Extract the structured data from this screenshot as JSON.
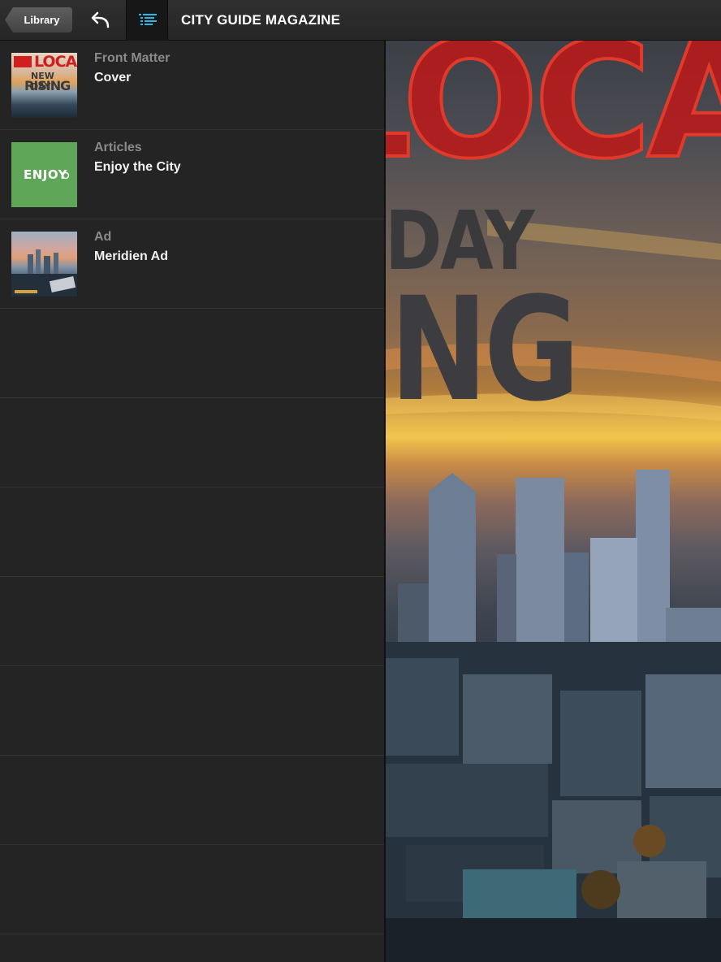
{
  "toolbar": {
    "back_label": "Library",
    "title": "CITY GUIDE MAGAZINE",
    "accent_color": "#2bb8e6"
  },
  "toc": {
    "items": [
      {
        "section": "Front Matter",
        "title": "Cover",
        "thumbnail": "cover-thumbnail"
      },
      {
        "section": "Articles",
        "title": "Enjoy the City",
        "thumbnail": "enjoy-thumbnail"
      },
      {
        "section": "Ad",
        "title": "Meridien Ad",
        "thumbnail": "ad-thumbnail"
      }
    ]
  },
  "thumbnails": {
    "cover": {
      "line1": "LOCAL",
      "line2": "NEW DAY",
      "line3": "RISING"
    },
    "enjoy": {
      "text": "ENJOY"
    }
  },
  "cover_page": {
    "headline": "LOCAL",
    "line2": "DAY",
    "line3": "NG",
    "headline_color": "#c8241c"
  }
}
